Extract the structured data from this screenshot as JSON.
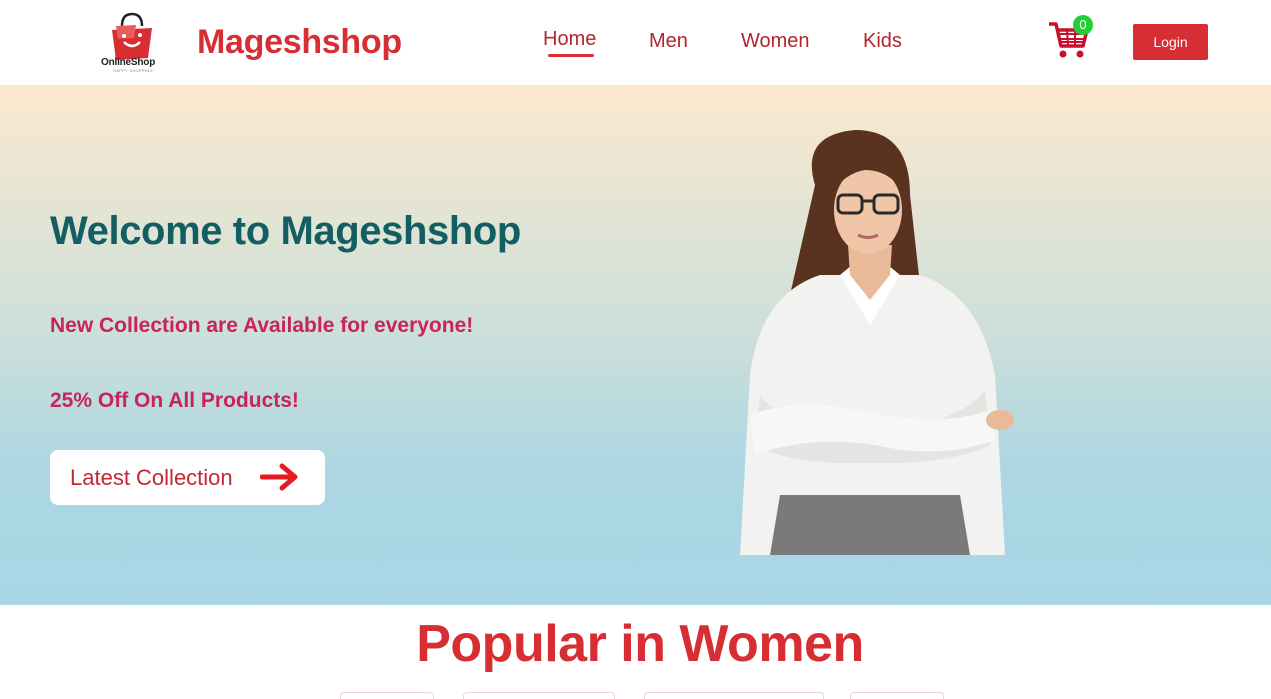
{
  "brand": {
    "name": "Mageshshop",
    "logo_text": "OnlineShop",
    "logo_tagline": "HAPPY SHOPPING",
    "color": "#d62e33"
  },
  "nav": {
    "links": [
      {
        "label": "Home",
        "active": true
      },
      {
        "label": "Men",
        "active": false
      },
      {
        "label": "Women",
        "active": false
      },
      {
        "label": "Kids",
        "active": false
      }
    ],
    "cart_count": "0",
    "cart_icon": "shopping-cart-icon",
    "login_label": "Login"
  },
  "hero": {
    "title": "Welcome to Mageshshop",
    "line1": "New Collection are Available for everyone!",
    "line2": "25% Off On All Products!",
    "cta_label": "Latest Collection",
    "cta_icon": "arrow-right-icon",
    "title_color": "#135e62",
    "text_color": "#c8235a"
  },
  "popular": {
    "title": "Popular in Women"
  }
}
